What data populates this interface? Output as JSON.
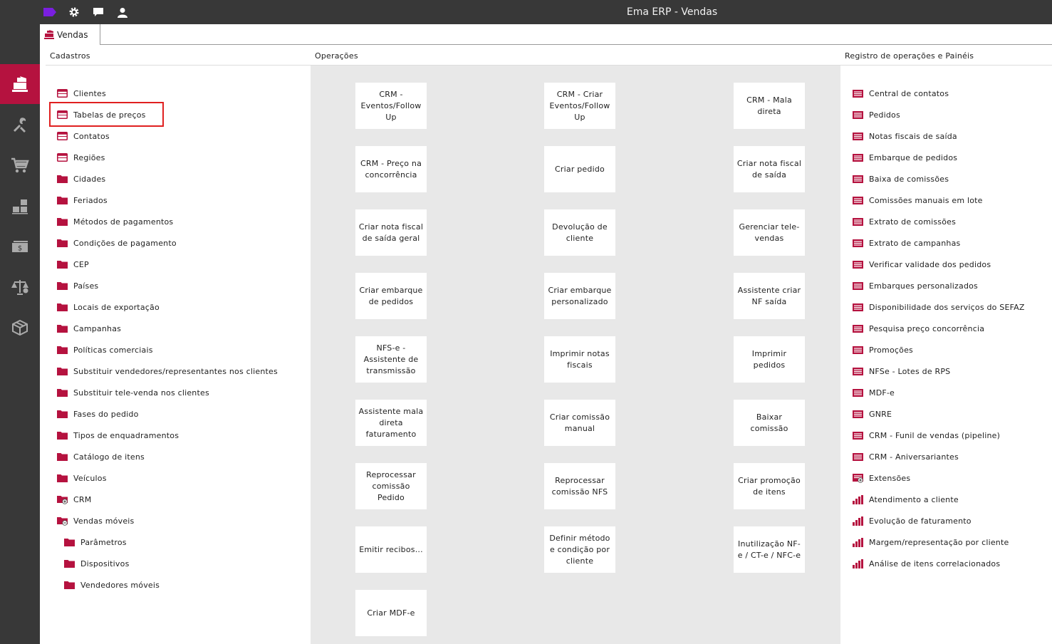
{
  "app": {
    "title": "Ema ERP - Vendas"
  },
  "toolbar": {
    "icons": [
      {
        "name": "tag-icon",
        "color": "#7a1fe0"
      },
      {
        "name": "gear-icon"
      },
      {
        "name": "chat-icon"
      },
      {
        "name": "user-icon"
      }
    ]
  },
  "sidebar": {
    "items": [
      {
        "name": "sales-register-icon",
        "active": true
      },
      {
        "name": "tools-icon"
      },
      {
        "name": "cart-icon"
      },
      {
        "name": "stacked-boxes-icon"
      },
      {
        "name": "money-icon"
      },
      {
        "name": "scale-icon"
      },
      {
        "name": "cube-icon"
      }
    ]
  },
  "tabs": [
    {
      "label": "Vendas"
    }
  ],
  "columns": {
    "cadastros": "Cadastros",
    "operacoes": "Operações",
    "registro": "Registro de operações e Painéis"
  },
  "cadastros": [
    {
      "label": "Clientes",
      "icon": "table-icon"
    },
    {
      "label": "Tabelas de preços",
      "icon": "table-icon",
      "highlighted": true
    },
    {
      "label": "Contatos",
      "icon": "table-icon"
    },
    {
      "label": "Regiões",
      "icon": "table-icon"
    },
    {
      "label": "Cidades",
      "icon": "folder-icon"
    },
    {
      "label": "Feriados",
      "icon": "folder-icon"
    },
    {
      "label": "Métodos de pagamentos",
      "icon": "folder-icon"
    },
    {
      "label": "Condições de pagamento",
      "icon": "folder-icon"
    },
    {
      "label": "CEP",
      "icon": "folder-icon"
    },
    {
      "label": "Países",
      "icon": "folder-icon"
    },
    {
      "label": "Locais de exportação",
      "icon": "folder-icon"
    },
    {
      "label": "Campanhas",
      "icon": "folder-icon"
    },
    {
      "label": "Políticas comerciais",
      "icon": "folder-icon"
    },
    {
      "label": "Substituir vendedores/representantes nos clientes",
      "icon": "folder-icon"
    },
    {
      "label": "Substituir tele-venda nos clientes",
      "icon": "folder-icon"
    },
    {
      "label": "Fases do pedido",
      "icon": "folder-icon"
    },
    {
      "label": "Tipos de enquadramentos",
      "icon": "folder-icon"
    },
    {
      "label": "Catálogo de itens",
      "icon": "folder-icon"
    },
    {
      "label": "Veículos",
      "icon": "folder-icon"
    },
    {
      "label": "CRM",
      "icon": "folder-plus-icon"
    },
    {
      "label": "Vendas móveis",
      "icon": "folder-minus-icon"
    },
    {
      "label": "Parâmetros",
      "icon": "folder-icon",
      "indent": true
    },
    {
      "label": "Dispositivos",
      "icon": "folder-icon",
      "indent": true
    },
    {
      "label": "Vendedores móveis",
      "icon": "folder-icon",
      "indent": true
    }
  ],
  "operacoes": [
    [
      "CRM - Eventos/Follow Up",
      "CRM - Criar Eventos/Follow Up",
      "CRM - Mala direta"
    ],
    [
      "CRM - Preço na concorrência",
      "Criar pedido",
      "Criar nota fiscal de saída"
    ],
    [
      "Criar nota fiscal de saída geral",
      "Devolução de cliente",
      "Gerenciar tele-vendas"
    ],
    [
      "Criar embarque de pedidos",
      "Criar embarque personalizado",
      "Assistente criar NF saída"
    ],
    [
      "NFS-e - Assistente de transmissão",
      "Imprimir notas fiscais",
      "Imprimir pedidos"
    ],
    [
      "Assistente mala direta faturamento",
      "Criar comissão manual",
      "Baixar comissão"
    ],
    [
      "Reprocessar comissão Pedido",
      "Reprocessar comissão NFS",
      "Criar promoção de itens"
    ],
    [
      "Emitir recibos...",
      "Definir método e condição por cliente",
      "Inutilização NF-e / CT-e / NFC-e"
    ],
    [
      "Criar MDF-e"
    ]
  ],
  "registro": [
    {
      "label": "Central de contatos",
      "icon": "list-icon"
    },
    {
      "label": "Pedidos",
      "icon": "list-icon"
    },
    {
      "label": "Notas fiscais de saída",
      "icon": "list-icon"
    },
    {
      "label": "Embarque de pedidos",
      "icon": "list-icon"
    },
    {
      "label": "Baixa de comissões",
      "icon": "list-icon"
    },
    {
      "label": "Comissões manuais em lote",
      "icon": "list-icon"
    },
    {
      "label": "Extrato de comissões",
      "icon": "list-icon"
    },
    {
      "label": "Extrato de campanhas",
      "icon": "list-icon"
    },
    {
      "label": "Verificar validade dos pedidos",
      "icon": "list-icon"
    },
    {
      "label": "Embarques personalizados",
      "icon": "list-icon"
    },
    {
      "label": "Disponibilidade dos serviços do SEFAZ",
      "icon": "list-icon"
    },
    {
      "label": "Pesquisa preço concorrência",
      "icon": "list-icon"
    },
    {
      "label": "Promoções",
      "icon": "list-icon"
    },
    {
      "label": "NFSe - Lotes de RPS",
      "icon": "list-icon"
    },
    {
      "label": "MDF-e",
      "icon": "list-icon"
    },
    {
      "label": "GNRE",
      "icon": "list-icon"
    },
    {
      "label": "CRM - Funil de vendas (pipeline)",
      "icon": "list-icon"
    },
    {
      "label": "CRM - Aniversariantes",
      "icon": "list-icon"
    },
    {
      "label": "Extensões",
      "icon": "list-plus-icon"
    },
    {
      "label": "Atendimento a cliente",
      "icon": "bar-chart-icon"
    },
    {
      "label": "Evolução de faturamento",
      "icon": "bar-chart-icon"
    },
    {
      "label": "Margem/representação por cliente",
      "icon": "bar-chart-icon"
    },
    {
      "label": "Análise de itens correlacionados",
      "icon": "bar-chart-icon"
    }
  ],
  "colors": {
    "accent": "#b5123f",
    "chrome": "#383838",
    "ops_bg": "#e8e8e8",
    "highlight": "#e02020"
  }
}
